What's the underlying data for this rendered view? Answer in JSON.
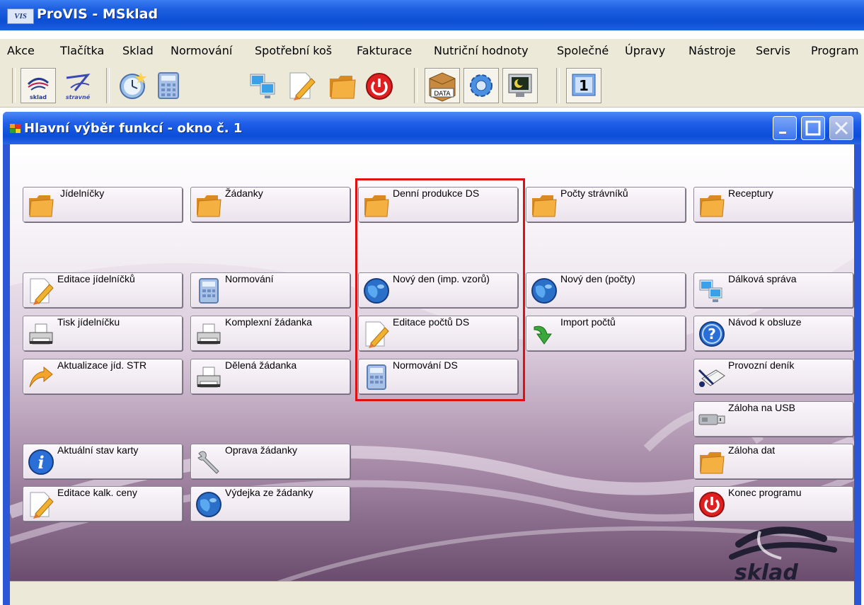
{
  "app": {
    "logo_text": "VIS",
    "title": "ProVIS - MSklad"
  },
  "menu": [
    "Akce",
    "Tlačítka",
    "Sklad",
    "Normování",
    "Spotřební koš",
    "Fakturace",
    "Nutriční hodnoty",
    "Společné",
    "Úpravy",
    "Nástroje",
    "Servis",
    "Program"
  ],
  "toolbar": {
    "icons": [
      "sklad-icon",
      "stravne-icon",
      "clock-icon",
      "calculator-icon",
      "remote-computers-icon",
      "edit-pencil-icon",
      "folder-icon",
      "power-icon",
      "data-box-icon",
      "settings-gear-icon",
      "monitor-icon",
      "window-number-icon"
    ],
    "sklad_label": "sklad",
    "stravne_label": "stravné",
    "data_label": "DATA",
    "window_number": "1"
  },
  "window": {
    "title": "Hlavní výběr funkcí - okno č. 1"
  },
  "buttons": [
    {
      "label": "Jídelníčky",
      "icon": "folder-icon"
    },
    {
      "label": "Žádanky",
      "icon": "folder-icon"
    },
    {
      "label": "Denní produkce DS",
      "icon": "folder-icon"
    },
    {
      "label": "Počty strávníků",
      "icon": "folder-icon"
    },
    {
      "label": "Receptury",
      "icon": "folder-icon"
    },
    {
      "label": "Editace jídelníčků",
      "icon": "edit-pencil-icon"
    },
    {
      "label": "Normování",
      "icon": "calculator-icon"
    },
    {
      "label": "Nový den (imp. vzorů)",
      "icon": "globe-icon"
    },
    {
      "label": "Nový den (počty)",
      "icon": "globe-icon"
    },
    {
      "label": "Dálková správa",
      "icon": "remote-computers-icon"
    },
    {
      "label": "Tisk jídelníčku",
      "icon": "printer-icon"
    },
    {
      "label": "Komplexní žádanka",
      "icon": "printer-icon"
    },
    {
      "label": "Editace počtů DS",
      "icon": "edit-pencil-icon"
    },
    {
      "label": "Import počtů",
      "icon": "import-arrow-icon"
    },
    {
      "label": "Návod k obsluze",
      "icon": "help-icon"
    },
    {
      "label": "Aktualizace jíd. STR",
      "icon": "update-arrow-icon"
    },
    {
      "label": "Dělená žádanka",
      "icon": "printer-icon"
    },
    {
      "label": "Normování DS",
      "icon": "calculator-icon"
    },
    {
      "label": "Provozní deník",
      "icon": "diary-pen-icon"
    },
    {
      "label": "Záloha na USB",
      "icon": "usb-drive-icon"
    },
    {
      "label": "Aktuální stav karty",
      "icon": "info-icon"
    },
    {
      "label": "Oprava žádanky",
      "icon": "wrench-icon"
    },
    {
      "label": "Záloha dat",
      "icon": "folder-icon"
    },
    {
      "label": "Editace kalk. ceny",
      "icon": "edit-pencil-icon"
    },
    {
      "label": "Výdejka ze žádanky",
      "icon": "globe-icon"
    },
    {
      "label": "Konec programu",
      "icon": "power-icon"
    }
  ],
  "brand": {
    "text": "sklad"
  },
  "colors": {
    "titlebar": "#0b4fd4",
    "highlight": "#e01010",
    "button_face": "#f4eef5"
  }
}
